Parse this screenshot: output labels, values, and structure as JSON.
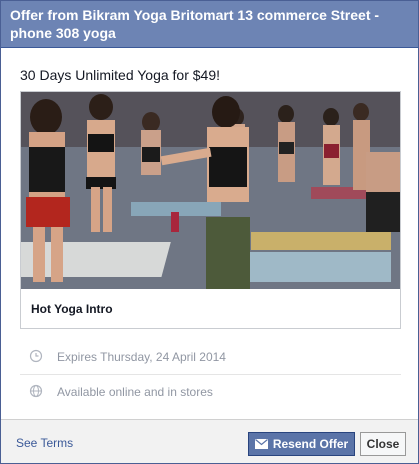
{
  "dialog": {
    "title": "Offer from Bikram Yoga Britomart 13 commerce Street - phone 308 yoga"
  },
  "offer": {
    "headline": "30 Days Unlimited Yoga for $49!",
    "card_title": "Hot Yoga Intro",
    "expires": "Expires Thursday, 24 April 2014",
    "availability": "Available online and in stores"
  },
  "footer": {
    "see_terms": "See Terms",
    "resend_label": "Resend Offer",
    "close_label": "Close"
  },
  "icons": {
    "expires": "clock-icon",
    "availability": "globe-icon",
    "resend": "envelope-icon"
  },
  "colors": {
    "header_bg": "#6d84b4",
    "link": "#3b5998",
    "primary_button": "#5b74a8",
    "muted_text": "#9197a3"
  }
}
